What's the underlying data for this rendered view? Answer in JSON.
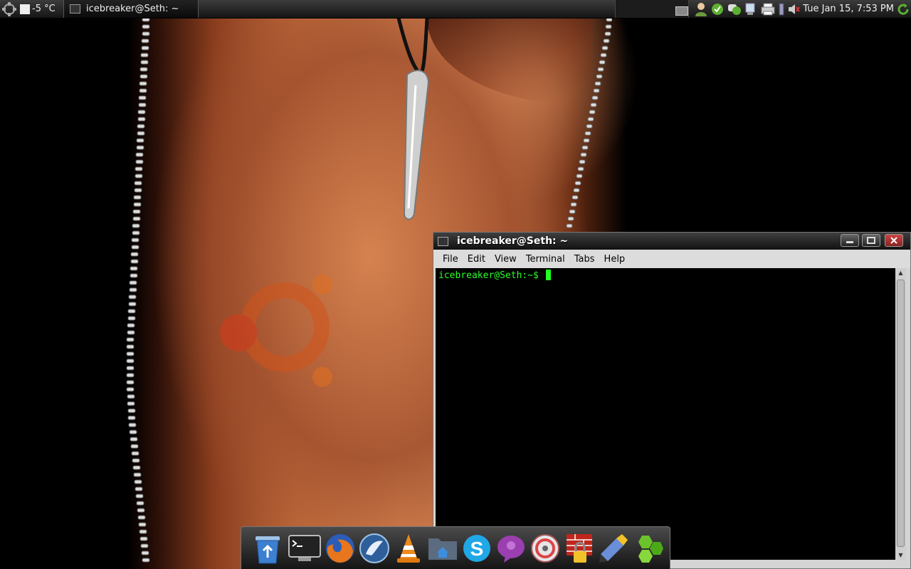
{
  "top_panel": {
    "weather": {
      "temperature": "-5 °C",
      "icon": "weather-cloud-icon"
    },
    "task": {
      "title": "icebreaker@Seth: ~",
      "icon": "terminal-icon"
    },
    "workspaces": {
      "count": 2,
      "active": 2
    },
    "tray_icons": [
      "user-icon",
      "pidgin-status-icon",
      "chat-icon",
      "network-icon",
      "printer-icon",
      "battery-icon",
      "volume-mute-icon"
    ],
    "clock": "Tue Jan 15,  7:53 PM",
    "update_icon": "refresh-icon"
  },
  "terminal_window": {
    "title": "icebreaker@Seth: ~",
    "menu": [
      "File",
      "Edit",
      "View",
      "Terminal",
      "Tabs",
      "Help"
    ],
    "prompt": "icebreaker@Seth:~$ ",
    "buttons": [
      "minimize",
      "maximize",
      "close"
    ]
  },
  "dock": {
    "items": [
      {
        "name": "trash",
        "icon": "recycle-bin-icon"
      },
      {
        "name": "terminal",
        "icon": "terminal-icon"
      },
      {
        "name": "firefox",
        "icon": "firefox-icon"
      },
      {
        "name": "songbird",
        "icon": "music-player-icon"
      },
      {
        "name": "vlc",
        "icon": "vlc-cone-icon"
      },
      {
        "name": "home-folder",
        "icon": "home-folder-icon"
      },
      {
        "name": "skype",
        "icon": "skype-icon"
      },
      {
        "name": "empathy",
        "icon": "chat-bubble-icon"
      },
      {
        "name": "brasero",
        "icon": "disc-burner-icon"
      },
      {
        "name": "firestarter",
        "icon": "firewall-lock-icon"
      },
      {
        "name": "gedit",
        "icon": "text-editor-icon"
      },
      {
        "name": "hexagons",
        "icon": "hexagon-app-icon"
      }
    ]
  },
  "colors": {
    "prompt": "#2aff2a",
    "panel": "#1a1a1a",
    "terminal_bg": "#000000"
  }
}
